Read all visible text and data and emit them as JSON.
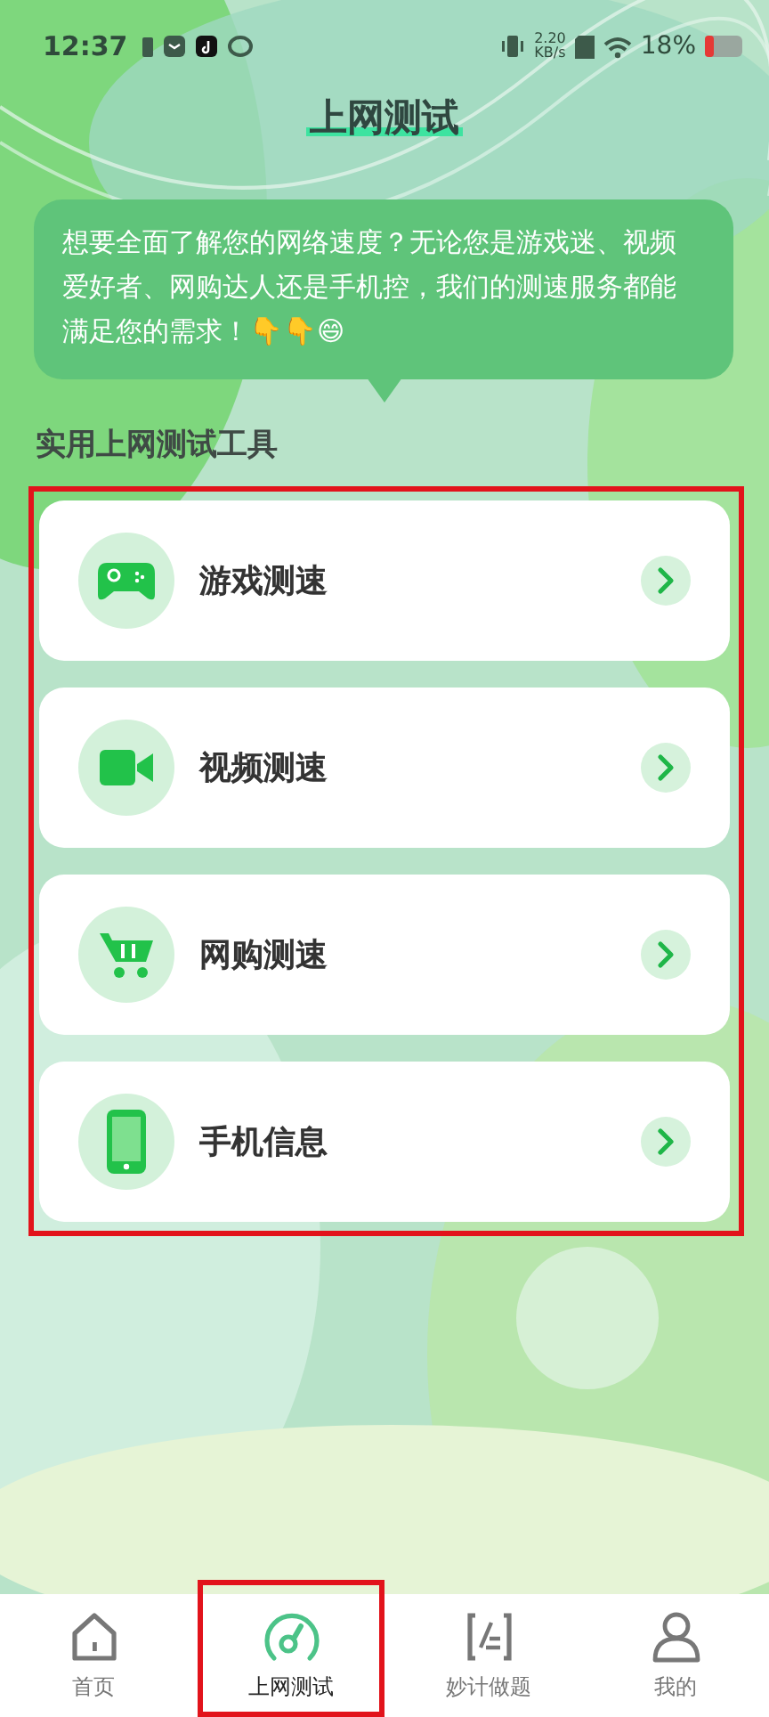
{
  "status_bar": {
    "time": "12:37",
    "speed": "2.20",
    "speed_unit": "KB/s",
    "battery": "18%"
  },
  "header": {
    "title": "上网测试"
  },
  "bubble": {
    "text": "想要全面了解您的网络速度？无论您是游戏迷、视频爱好者、网购达人还是手机控，我们的测速服务都能满足您的需求！👇👇😄"
  },
  "section": {
    "title": "实用上网测试工具"
  },
  "tools": [
    {
      "kind": "game",
      "label": "游戏测速"
    },
    {
      "kind": "video",
      "label": "视频测速"
    },
    {
      "kind": "shop",
      "label": "网购测速"
    },
    {
      "kind": "phone",
      "label": "手机信息"
    }
  ],
  "tabs": [
    {
      "kind": "home",
      "label": "首页",
      "selected": false
    },
    {
      "kind": "speed",
      "label": "上网测试",
      "selected": true
    },
    {
      "kind": "quiz",
      "label": "妙计做题",
      "selected": false
    },
    {
      "kind": "me",
      "label": "我的",
      "selected": false
    }
  ]
}
